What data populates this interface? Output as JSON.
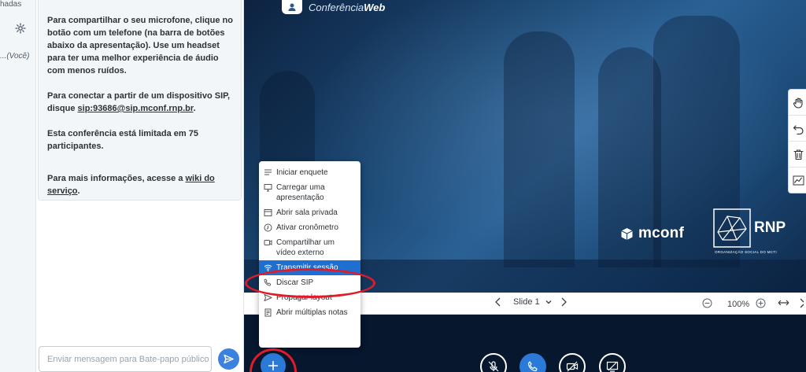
{
  "user_list": {
    "label_top": "hadas",
    "label_you": "...(Você)",
    "settings_icon": "gear-icon"
  },
  "chat": {
    "welcome_paragraphs": {
      "p1": "Para compartilhar o seu microfone, clique no botão com um telefone (na barra de botões abaixo da apresentação). Use um headset para ter uma melhor experiência de áudio com menos ruídos.",
      "p2_prefix": "Para conectar a partir de um dispositivo SIP, disque ",
      "p2_link": "sip:93686@sip.mconf.rnp.br",
      "p2_suffix": ".",
      "p3": "Esta conferência está limitada em 75 participantes.",
      "p4_prefix": "Para mais informações, acesse a ",
      "p4_link": "wiki do serviço",
      "p4_suffix": "."
    },
    "input_placeholder": "Enviar mensagem para Bate-papo público",
    "send_icon": "send-icon"
  },
  "presentation": {
    "brand_prefix": "Conferência",
    "brand_suffix": "Web",
    "mconf_logo": "mconf",
    "rnp_logo": "RNP",
    "rnp_subtitle": "ORGANIZAÇÃO SOCIAL DO MCTI",
    "tools": [
      "hand-icon",
      "undo-icon",
      "trash-icon",
      "multi-user-icon"
    ]
  },
  "slide_controls": {
    "slide_label": "Slide 1",
    "zoom": "100%"
  },
  "actions_menu": {
    "items": [
      {
        "label": "Iniciar enquete",
        "icon": "poll-icon"
      },
      {
        "label": "Carregar uma apresentação",
        "icon": "upload-presentation-icon"
      },
      {
        "label": "Abrir sala privada",
        "icon": "breakout-room-icon"
      },
      {
        "label": "Ativar cronômetro",
        "icon": "timer-icon"
      },
      {
        "label": "Compartilhar um vídeo externo",
        "icon": "external-video-icon"
      },
      {
        "label": "Transmitir sessão",
        "icon": "broadcast-icon"
      },
      {
        "label": "Discar SIP",
        "icon": "phone-icon"
      },
      {
        "label": "Propagar layout",
        "icon": "send-layout-icon"
      },
      {
        "label": "Abrir múltiplas notas",
        "icon": "notes-icon"
      }
    ],
    "active_index": 5
  },
  "action_bar": {
    "buttons": [
      "plus-icon",
      "mic-muted-icon",
      "phone-icon",
      "camera-off-icon",
      "screen-share-off-icon"
    ]
  },
  "colors": {
    "accent": "#2b7ad8",
    "highlight": "#e01c2a",
    "action_bar": "#06172e"
  }
}
